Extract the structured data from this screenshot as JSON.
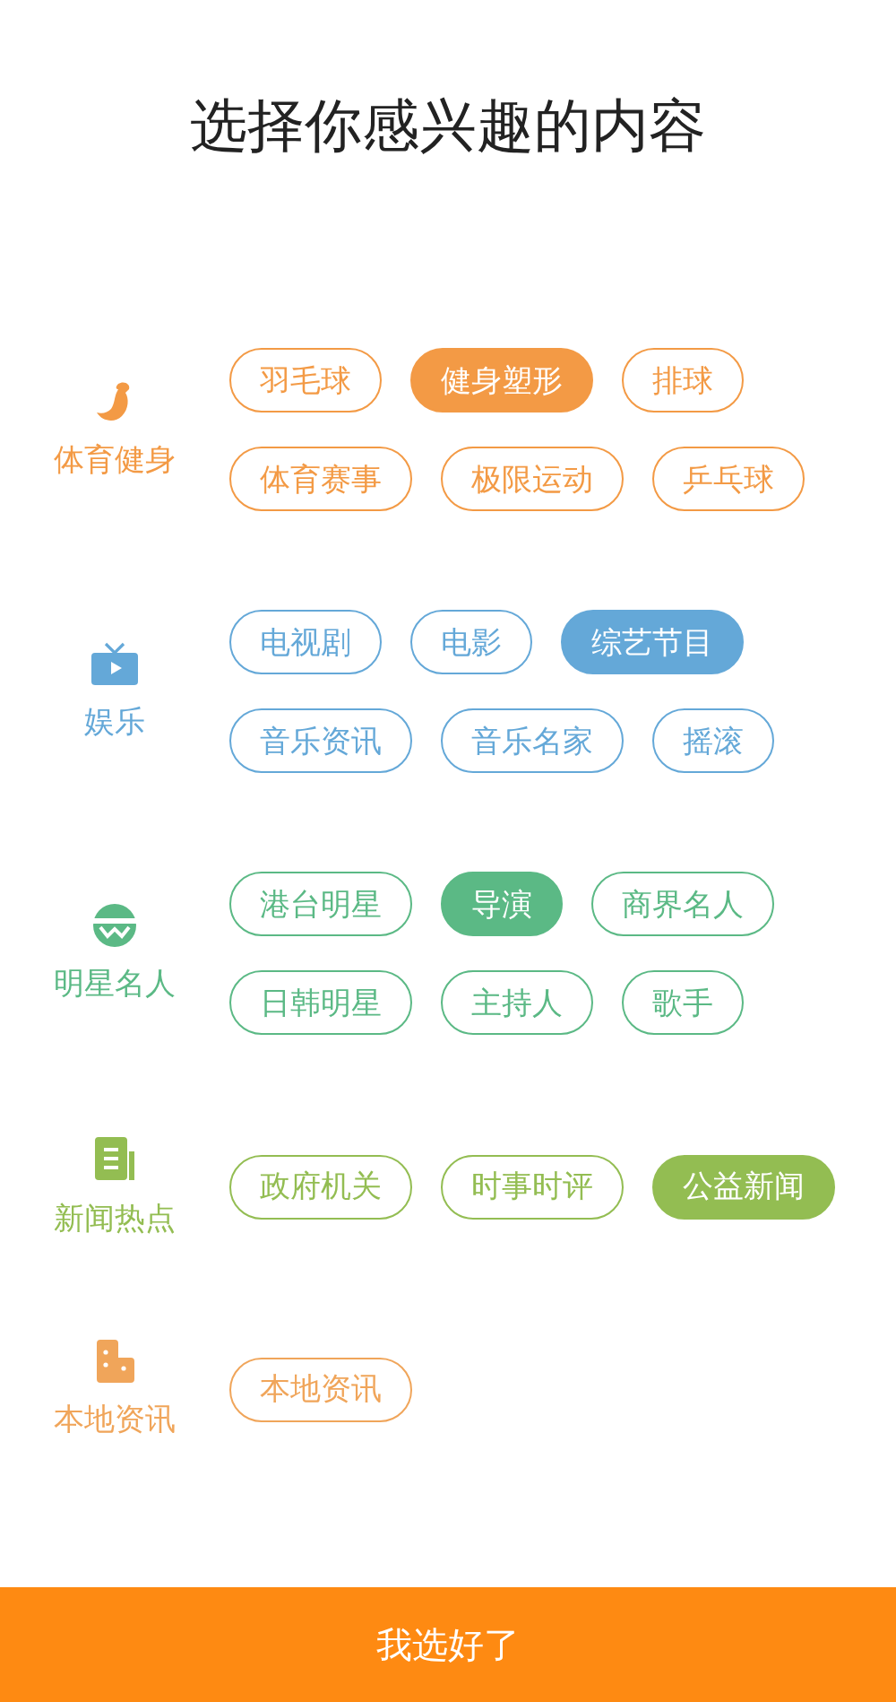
{
  "title": "选择你感兴趣的内容",
  "categories": [
    {
      "name": "体育健身",
      "kind": "muscle",
      "color": "#f39a45",
      "tags": [
        {
          "label": "羽毛球",
          "selected": false
        },
        {
          "label": "健身塑形",
          "selected": true
        },
        {
          "label": "排球",
          "selected": false
        },
        {
          "label": "体育赛事",
          "selected": false
        },
        {
          "label": "极限运动",
          "selected": false
        },
        {
          "label": "乒乓球",
          "selected": false
        }
      ]
    },
    {
      "name": "娱乐",
      "kind": "tv",
      "color": "#64a8d8",
      "tags": [
        {
          "label": "电视剧",
          "selected": false
        },
        {
          "label": "电影",
          "selected": false
        },
        {
          "label": "综艺节目",
          "selected": true
        },
        {
          "label": "音乐资讯",
          "selected": false
        },
        {
          "label": "音乐名家",
          "selected": false
        },
        {
          "label": "摇滚",
          "selected": false
        }
      ]
    },
    {
      "name": "明星名人",
      "kind": "face",
      "color": "#5bb985",
      "tags": [
        {
          "label": "港台明星",
          "selected": false
        },
        {
          "label": "导演",
          "selected": true
        },
        {
          "label": "商界名人",
          "selected": false
        },
        {
          "label": "日韩明星",
          "selected": false
        },
        {
          "label": "主持人",
          "selected": false
        },
        {
          "label": "歌手",
          "selected": false
        }
      ]
    },
    {
      "name": "新闻热点",
      "kind": "document",
      "color": "#93bd52",
      "tags": [
        {
          "label": "政府机关",
          "selected": false
        },
        {
          "label": "时事时评",
          "selected": false
        },
        {
          "label": "公益新闻",
          "selected": true
        }
      ]
    },
    {
      "name": "本地资讯",
      "kind": "building",
      "color": "#f0a55a",
      "tags": [
        {
          "label": "本地资讯",
          "selected": false
        }
      ]
    }
  ],
  "confirm_button": "我选好了"
}
